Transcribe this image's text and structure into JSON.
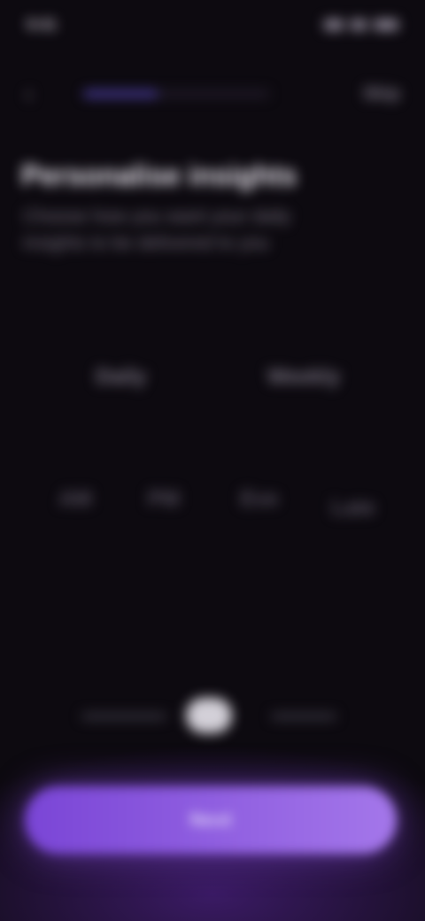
{
  "status_bar": {
    "time": "9:41",
    "icons": [
      "signal-icon",
      "wifi-icon",
      "battery-icon"
    ]
  },
  "nav": {
    "back_icon": "chevron-left-icon",
    "progress": 0.4,
    "skip_label": "Skip"
  },
  "header": {
    "title": "Personalise insights",
    "subtitle": "Choose how you want your daily insights to be delivered to you"
  },
  "toggle": {
    "left_label": "Daily",
    "right_label": "Weekly"
  },
  "options": [
    "AM",
    "PM",
    "Eve",
    "Late"
  ],
  "pager": {
    "active_index": 1,
    "count": 3
  },
  "cta": {
    "label": "Next"
  },
  "colors": {
    "background": "#0d0a10",
    "accent": "#8f5ae0",
    "progress": "#4a3d9e"
  }
}
